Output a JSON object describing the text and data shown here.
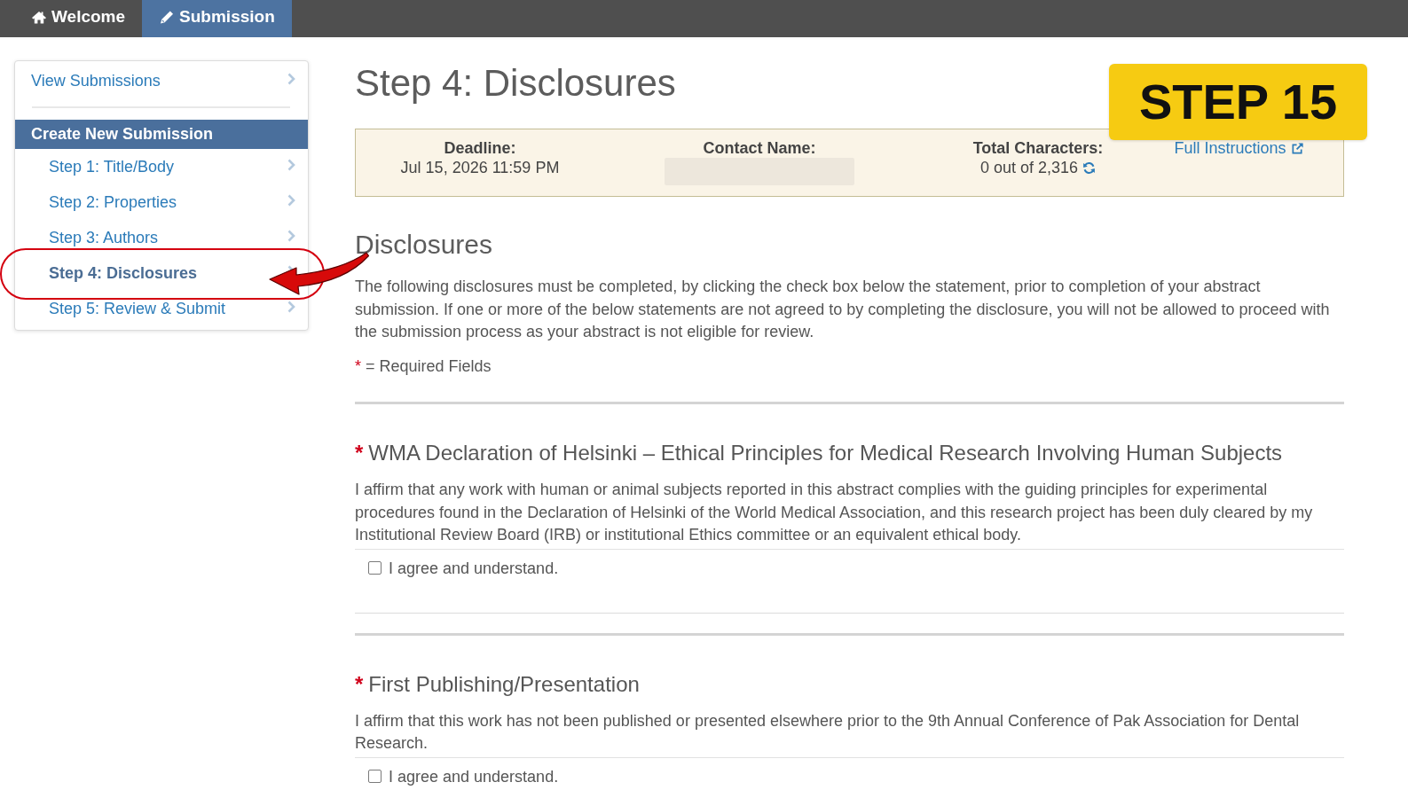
{
  "nav_tabs": [
    {
      "label": "Welcome",
      "selected": false
    },
    {
      "label": "Submission",
      "selected": true
    }
  ],
  "sidebar": {
    "links": [
      {
        "label": "View Submissions"
      }
    ],
    "group_title": "Create New Submission",
    "steps": [
      {
        "label": "Step 1: Title/Body",
        "selected": false
      },
      {
        "label": "Step 2: Properties",
        "selected": false
      },
      {
        "label": "Step 3: Authors",
        "selected": false
      },
      {
        "label": "Step 4: Disclosures",
        "selected": true
      },
      {
        "label": "Step 5: Review & Submit",
        "selected": false
      }
    ]
  },
  "page_title": "Step 4: Disclosures",
  "info_bar": [
    {
      "kind": "field",
      "label": "Deadline:",
      "value": "Jul 15, 2026 11:59 PM"
    },
    {
      "kind": "redacted",
      "label": "Contact Name:"
    },
    {
      "kind": "counter",
      "label": "Total Characters:",
      "value": "0 out of 2,316"
    },
    {
      "kind": "link",
      "label": "Full Instructions"
    }
  ],
  "disclosures": {
    "title": "Disclosures",
    "intro": "The following disclosures must be completed, by clicking the check box below the statement, prior to completion of your abstract submission. If one or more of the below statements are not agreed to by completing the disclosure, you will not be allowed to proceed with the submission process as your abstract is not eligible for review.",
    "required_note": {
      "mark": "*",
      "text": "= Required Fields"
    }
  },
  "sections": [
    {
      "mark": "*",
      "title": "WMA Declaration of Helsinki – Ethical Principles for Medical Research Involving Human Subjects",
      "statement": "I affirm that any work with human or animal subjects reported in this abstract complies with the guiding principles for experimental procedures found in the Declaration of Helsinki of the World Medical Association, and this research project has been duly cleared by my Institutional Review Board (IRB) or institutional Ethics committee or an equivalent ethical body.",
      "agreement": {
        "label": "I agree and understand.",
        "checked": false
      }
    },
    {
      "mark": "*",
      "title": "First Publishing/Presentation",
      "statement": "I affirm that this work has not been published or presented elsewhere prior to the 9th Annual Conference of Pak Association for Dental Research.",
      "agreement": {
        "label": "I agree and understand.",
        "checked": false
      }
    }
  ],
  "overlay_badge": "STEP 15"
}
